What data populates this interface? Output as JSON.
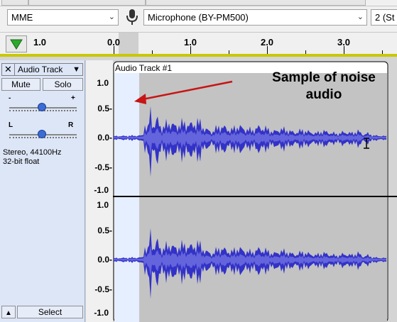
{
  "device_toolbar": {
    "host": "MME",
    "input_device": "Microphone (BY-PM500)",
    "channels": "2 (St"
  },
  "ruler": {
    "labels": [
      "1.0",
      "0.0",
      "1.0",
      "2.0",
      "3.0"
    ]
  },
  "track": {
    "name": "Audio Track",
    "clip_name": "Audio Track #1",
    "mute_label": "Mute",
    "solo_label": "Solo",
    "gain_minus": "-",
    "gain_plus": "+",
    "pan_left": "L",
    "pan_right": "R",
    "info_line1": "Stereo, 44100Hz",
    "info_line2": "32-bit float",
    "select_label": "Select",
    "close_glyph": "✕",
    "menu_arrow": "▼",
    "collapse_arrow": "▲"
  },
  "scale_labels": [
    "1.0",
    "0.5-",
    "0.0-",
    "-0.5-",
    "-1.0"
  ],
  "annotation": {
    "line1": "Sample of noise",
    "line2": "audio"
  },
  "colors": {
    "waveform": "#3232c8",
    "waveform_rms": "#6464dc",
    "selection_bg": "#c3c3c3",
    "unselected_bg": "#e6efff",
    "arrow": "#c81414"
  }
}
